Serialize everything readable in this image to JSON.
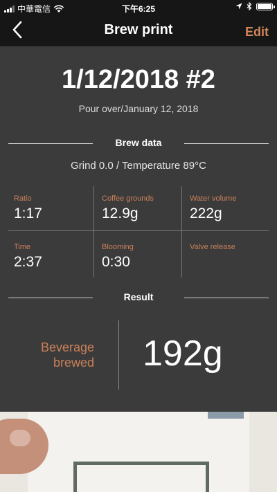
{
  "status": {
    "carrier": "中華電信",
    "time": "下午6:25"
  },
  "nav": {
    "title": "Brew print",
    "edit_label": "Edit"
  },
  "brew": {
    "title": "1/12/2018 #2",
    "subtitle": "Pour over/January 12, 2018",
    "section_brew_data": "Brew data",
    "grind_temp": "Grind 0.0 / Temperature 89°C",
    "metrics": [
      {
        "label": "Ratio",
        "value": "1:17"
      },
      {
        "label": "Coffee grounds",
        "value": "12.9g"
      },
      {
        "label": "Water volume",
        "value": "222g"
      },
      {
        "label": "Time",
        "value": "2:37"
      },
      {
        "label": "Blooming",
        "value": "0:30"
      },
      {
        "label": "Valve release",
        "value": ""
      }
    ],
    "section_result": "Result",
    "result_label_line1": "Beverage",
    "result_label_line2": "brewed",
    "result_value": "192g"
  },
  "colors": {
    "accent": "#d0865c",
    "background": "#3b3b3b",
    "bar": "#161616"
  }
}
